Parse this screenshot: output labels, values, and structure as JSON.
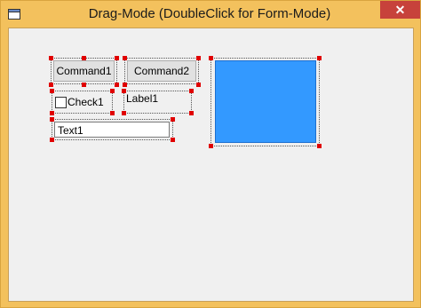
{
  "window": {
    "title": "Drag-Mode (DoubleClick for Form-Mode)",
    "close_label": "✕"
  },
  "controls": {
    "command1": "Command1",
    "command2": "Command2",
    "check1": "Check1",
    "label1": "Label1",
    "text1": "Text1"
  },
  "colors": {
    "shape_fill": "#3399ff",
    "handle": "#e00000",
    "close": "#c7423b"
  }
}
